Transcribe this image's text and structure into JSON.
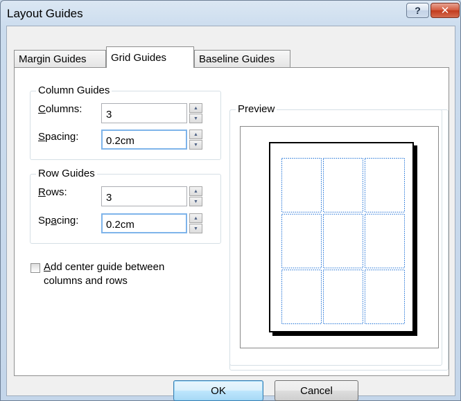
{
  "window": {
    "title": "Layout Guides",
    "help_glyph": "?",
    "close_glyph": "✕"
  },
  "tabs": [
    {
      "label": "Margin Guides",
      "active": false
    },
    {
      "label": "Grid Guides",
      "active": true
    },
    {
      "label": "Baseline Guides",
      "active": false
    }
  ],
  "column_guides": {
    "title": "Column Guides",
    "columns_label_accel": "C",
    "columns_label_rest": "olumns:",
    "columns_value": "3",
    "spacing_label_accel": "S",
    "spacing_label_rest": "pacing:",
    "spacing_value": "0.2cm"
  },
  "row_guides": {
    "title": "Row Guides",
    "rows_label_accel": "R",
    "rows_label_rest": "ows:",
    "rows_value": "3",
    "spacing_label_pre": "Sp",
    "spacing_label_accel": "a",
    "spacing_label_rest": "cing:",
    "spacing_value": "0.2cm"
  },
  "center_guide": {
    "label_accel": "A",
    "label_rest": "dd center guide between",
    "label_line2": "columns and rows",
    "checked": false
  },
  "preview": {
    "title": "Preview",
    "grid_columns": 3,
    "grid_rows": 3,
    "grid_color": "#1a6fd6"
  },
  "buttons": {
    "ok": "OK",
    "cancel": "Cancel"
  },
  "colors": {
    "focus_border": "#7eb4ea",
    "accent": "#3c7fb1"
  },
  "icons": {
    "spin_up": "▲",
    "spin_down": "▼"
  }
}
